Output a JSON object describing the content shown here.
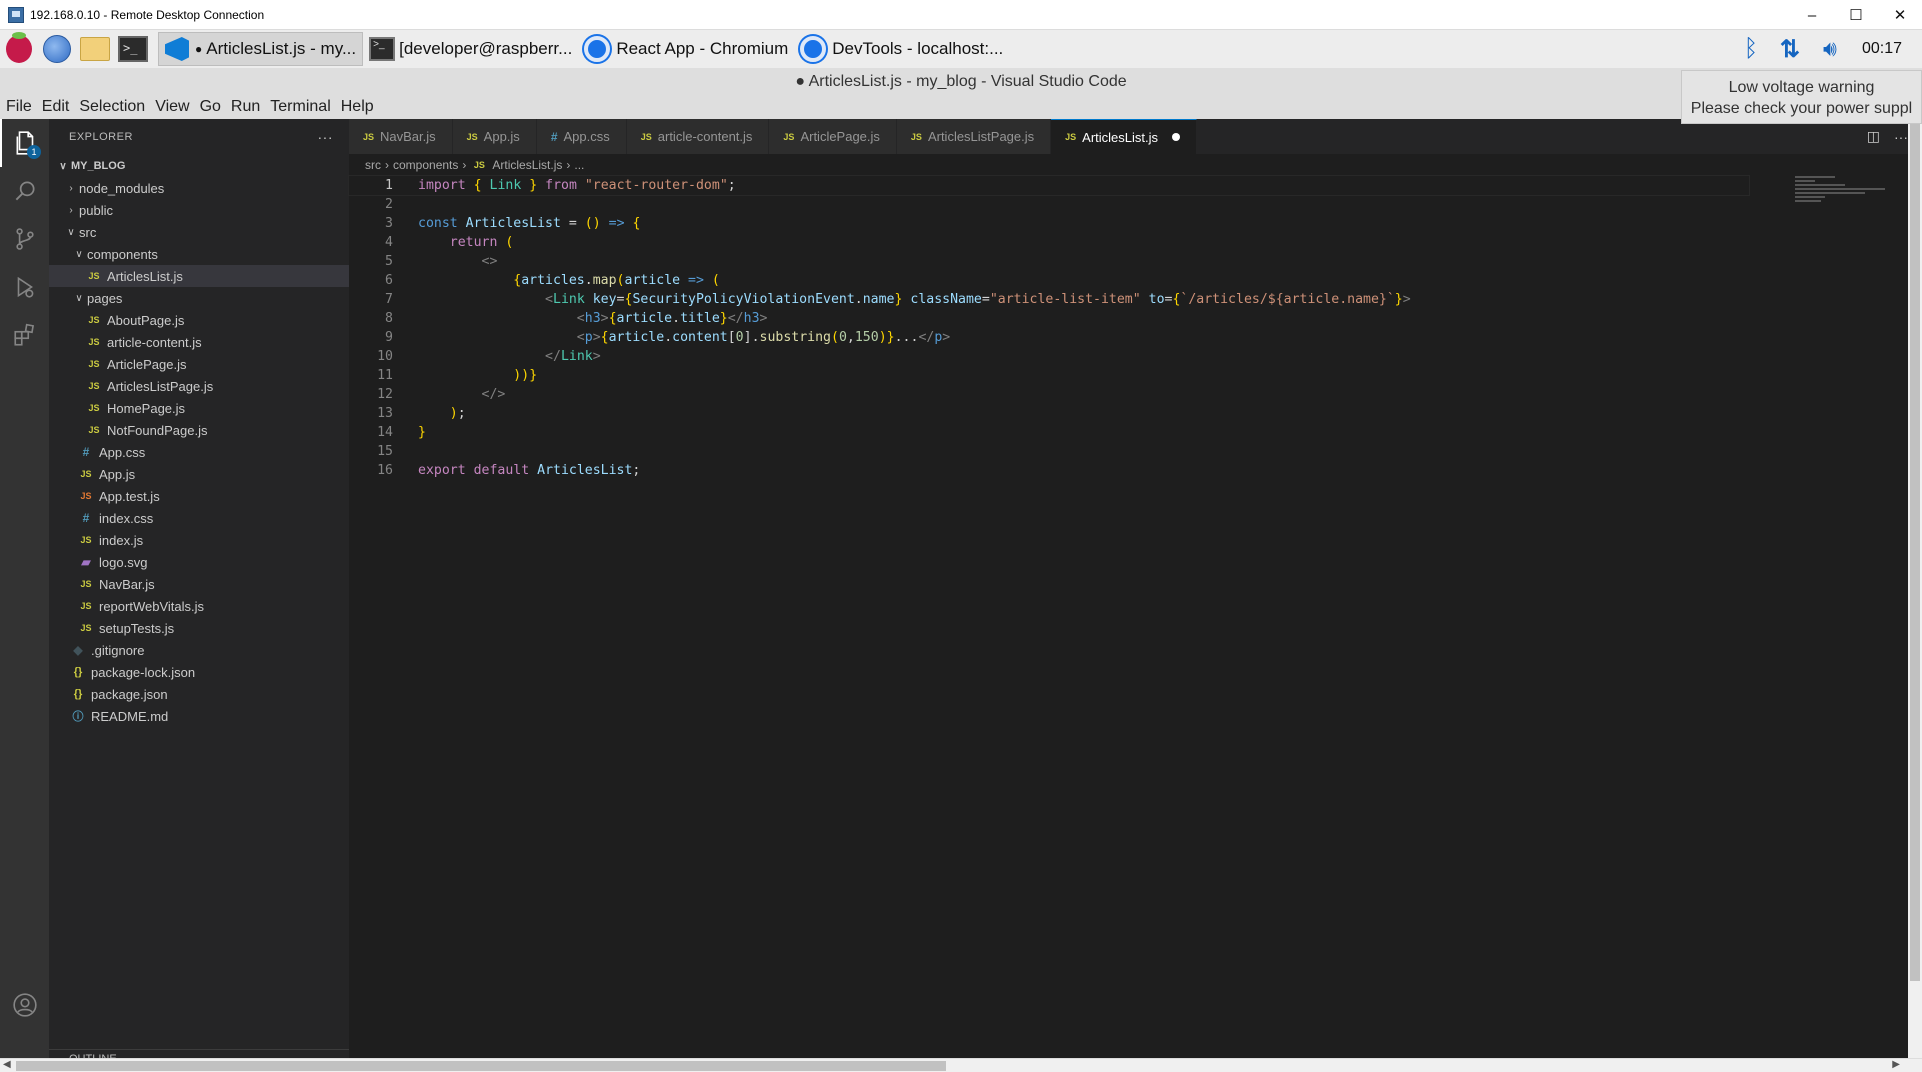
{
  "rdp": {
    "title": "192.168.0.10 - Remote Desktop Connection",
    "minimize": "–",
    "maximize": "☐",
    "close": "✕"
  },
  "taskbar": {
    "tasks": [
      {
        "label": "ArticlesList.js - my...",
        "icon": "vscode-icon",
        "active": true
      },
      {
        "label": "[developer@raspberr...",
        "icon": "terminal-icon",
        "active": false
      },
      {
        "label": "React App - Chromium",
        "icon": "chromium-icon",
        "active": false
      },
      {
        "label": "DevTools - localhost:...",
        "icon": "chromium-icon",
        "active": false
      }
    ],
    "clock": "00:17"
  },
  "vscode": {
    "window_title": "● ArticlesList.js - my_blog - Visual Studio Code",
    "menu": [
      "File",
      "Edit",
      "Selection",
      "View",
      "Go",
      "Run",
      "Terminal",
      "Help"
    ],
    "voltage_warning": {
      "line1": "Low voltage warning",
      "line2": "Please check your power suppl"
    }
  },
  "sidebar": {
    "header": "EXPLORER",
    "more": "···",
    "root": "MY_BLOG",
    "explorer_badge": "1",
    "tree": [
      {
        "label": "node_modules",
        "type": "folder",
        "depth": 1,
        "open": false
      },
      {
        "label": "public",
        "type": "folder",
        "depth": 1,
        "open": false
      },
      {
        "label": "src",
        "type": "folder",
        "depth": 1,
        "open": true
      },
      {
        "label": "components",
        "type": "folder",
        "depth": 2,
        "open": true
      },
      {
        "label": "ArticlesList.js",
        "type": "js",
        "depth": 3,
        "selected": true
      },
      {
        "label": "pages",
        "type": "folder",
        "depth": 2,
        "open": true
      },
      {
        "label": "AboutPage.js",
        "type": "js",
        "depth": 3
      },
      {
        "label": "article-content.js",
        "type": "js",
        "depth": 3
      },
      {
        "label": "ArticlePage.js",
        "type": "js",
        "depth": 3
      },
      {
        "label": "ArticlesListPage.js",
        "type": "js",
        "depth": 3
      },
      {
        "label": "HomePage.js",
        "type": "js",
        "depth": 3
      },
      {
        "label": "NotFoundPage.js",
        "type": "js",
        "depth": 3
      },
      {
        "label": "App.css",
        "type": "css",
        "depth": 2
      },
      {
        "label": "App.js",
        "type": "js",
        "depth": 2
      },
      {
        "label": "App.test.js",
        "type": "test",
        "depth": 2
      },
      {
        "label": "index.css",
        "type": "css",
        "depth": 2
      },
      {
        "label": "index.js",
        "type": "js",
        "depth": 2
      },
      {
        "label": "logo.svg",
        "type": "svg",
        "depth": 2
      },
      {
        "label": "NavBar.js",
        "type": "js",
        "depth": 2
      },
      {
        "label": "reportWebVitals.js",
        "type": "js",
        "depth": 2
      },
      {
        "label": "setupTests.js",
        "type": "js",
        "depth": 2
      },
      {
        "label": ".gitignore",
        "type": "git",
        "depth": 1
      },
      {
        "label": "package-lock.json",
        "type": "json",
        "depth": 1
      },
      {
        "label": "package.json",
        "type": "json",
        "depth": 1
      },
      {
        "label": "README.md",
        "type": "info",
        "depth": 1
      }
    ],
    "outline": "OUTLINE"
  },
  "tabs": [
    {
      "label": "NavBar.js",
      "type": "js"
    },
    {
      "label": "App.js",
      "type": "js"
    },
    {
      "label": "App.css",
      "type": "css"
    },
    {
      "label": "article-content.js",
      "type": "js"
    },
    {
      "label": "ArticlePage.js",
      "type": "js"
    },
    {
      "label": "ArticlesListPage.js",
      "type": "js"
    },
    {
      "label": "ArticlesList.js",
      "type": "js",
      "active": true,
      "dirty": true
    }
  ],
  "breadcrumb": [
    "src",
    "components",
    "ArticlesList.js",
    "..."
  ],
  "file_icon_text": {
    "js": "JS",
    "css": "#",
    "test": "JS",
    "svg": "▰",
    "git": "◆",
    "json": "{}",
    "info": "ⓘ"
  },
  "code": {
    "current_line": 1,
    "lines": [
      "import { Link } from \"react-router-dom\";",
      "",
      "const ArticlesList = () => {",
      "    return (",
      "        <>",
      "            {articles.map(article => (",
      "                <Link key={SecurityPolicyViolationEvent.name} className=\"article-list-item\" to={`/articles/${article.name}`}>",
      "                    <h3>{article.title}</h3>",
      "                    <p>{article.content[0].substring(0,150)}...</p>",
      "                </Link>",
      "            ))}",
      "        </>",
      "    );",
      "}",
      "",
      "export default ArticlesList;"
    ]
  }
}
